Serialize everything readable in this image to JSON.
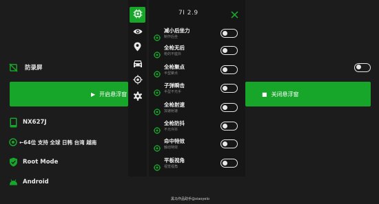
{
  "colors": {
    "accent": "#17a52a",
    "background": "#1c1c1c",
    "panel": "#161616"
  },
  "background_app": {
    "anti_record": {
      "label": "防录屏",
      "icon": "screen-off-icon",
      "enabled": false
    },
    "start_button": {
      "label": "开启悬浮窗",
      "icon": "play-icon"
    },
    "stop_button": {
      "label": "关闭悬浮窗",
      "icon": "stop-icon"
    },
    "device": {
      "label": "NX627J",
      "icon": "phone-icon"
    },
    "arch": {
      "label": "←64位 支持 全球 日韩 台湾 越南",
      "icon": "target-icon"
    },
    "root": {
      "label": "Root Mode",
      "icon": "shield-check-icon"
    },
    "os": {
      "label": "Android",
      "icon": "android-icon"
    }
  },
  "sidebar": {
    "items": [
      {
        "name": "sidebar-item-chip",
        "icon": "chip-icon",
        "active": true
      },
      {
        "name": "sidebar-item-eye",
        "icon": "eye-icon",
        "active": false
      },
      {
        "name": "sidebar-item-location",
        "icon": "location-pin-icon",
        "active": false
      },
      {
        "name": "sidebar-item-car",
        "icon": "car-icon",
        "active": false
      },
      {
        "name": "sidebar-item-crosshair",
        "icon": "crosshair-icon",
        "active": false
      },
      {
        "name": "sidebar-item-settings",
        "icon": "gear-icon",
        "active": false
      }
    ]
  },
  "panel": {
    "title": "7I 2.9",
    "close_icon": "close-icon",
    "features": [
      {
        "name": "减小后坐力",
        "desc": "制作后坐",
        "enabled": false
      },
      {
        "name": "全枪无后",
        "desc": "枪的不座抖",
        "enabled": false
      },
      {
        "name": "全枪聚点",
        "desc": "半型聚点",
        "enabled": false
      },
      {
        "name": "子弹瞬击",
        "desc": "半型不光手",
        "enabled": false
      },
      {
        "name": "全枪射速",
        "desc": "加速射速",
        "enabled": false
      },
      {
        "name": "全枪防抖",
        "desc": "不允许抖",
        "enabled": false
      },
      {
        "name": "命中特效",
        "desc": "触动特效",
        "enabled": false
      },
      {
        "name": "平板视角",
        "desc": "视觉视角",
        "enabled": false
      }
    ]
  },
  "footer": {
    "text": "黑马作品助手@xiaoyelo"
  }
}
